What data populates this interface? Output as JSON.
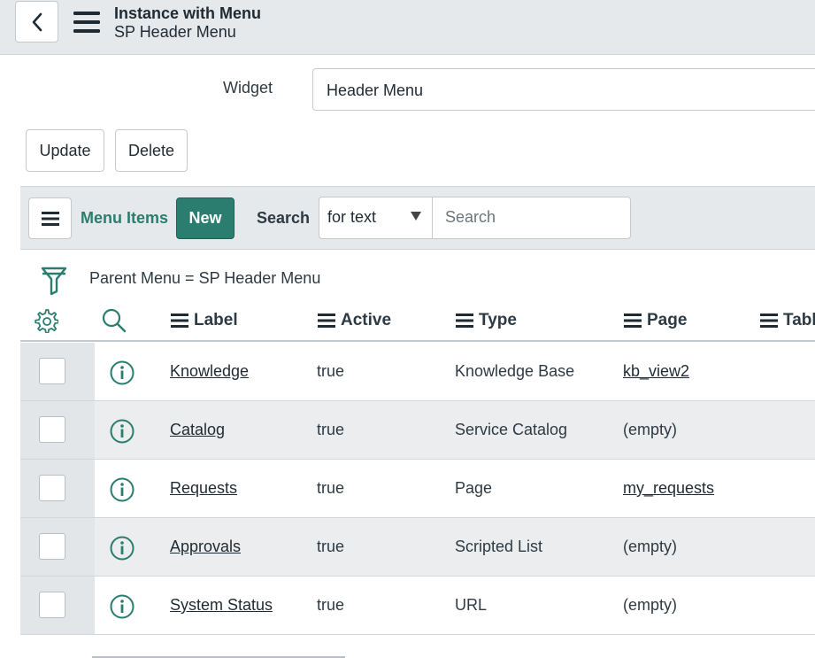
{
  "header": {
    "title": "Instance with Menu",
    "subtitle": "SP Header Menu",
    "back_icon": "chevron-left-icon",
    "menu_icon": "hamburger-icon"
  },
  "form": {
    "widget_label": "Widget",
    "widget_value": "Header Menu",
    "update_label": "Update",
    "delete_label": "Delete"
  },
  "list": {
    "title": "Menu Items",
    "new_label": "New",
    "search_label": "Search",
    "search_field": "for text",
    "search_placeholder": "Search",
    "filter": "Parent Menu = SP Header Menu",
    "columns": [
      "Label",
      "Active",
      "Type",
      "Page",
      "Table"
    ],
    "rows": [
      {
        "label": "Knowledge",
        "active": "true",
        "type": "Knowledge Base",
        "page": "kb_view2",
        "page_link": true
      },
      {
        "label": "Catalog",
        "active": "true",
        "type": "Service Catalog",
        "page": "(empty)",
        "page_link": false
      },
      {
        "label": "Requests",
        "active": "true",
        "type": "Page",
        "page": "my_requests",
        "page_link": true
      },
      {
        "label": "Approvals",
        "active": "true",
        "type": "Scripted List",
        "page": "(empty)",
        "page_link": false
      },
      {
        "label": "System Status",
        "active": "true",
        "type": "URL",
        "page": "(empty)",
        "page_link": false
      }
    ]
  },
  "colors": {
    "accent": "#2a7d6f",
    "header_bg": "#e6e9eb"
  }
}
